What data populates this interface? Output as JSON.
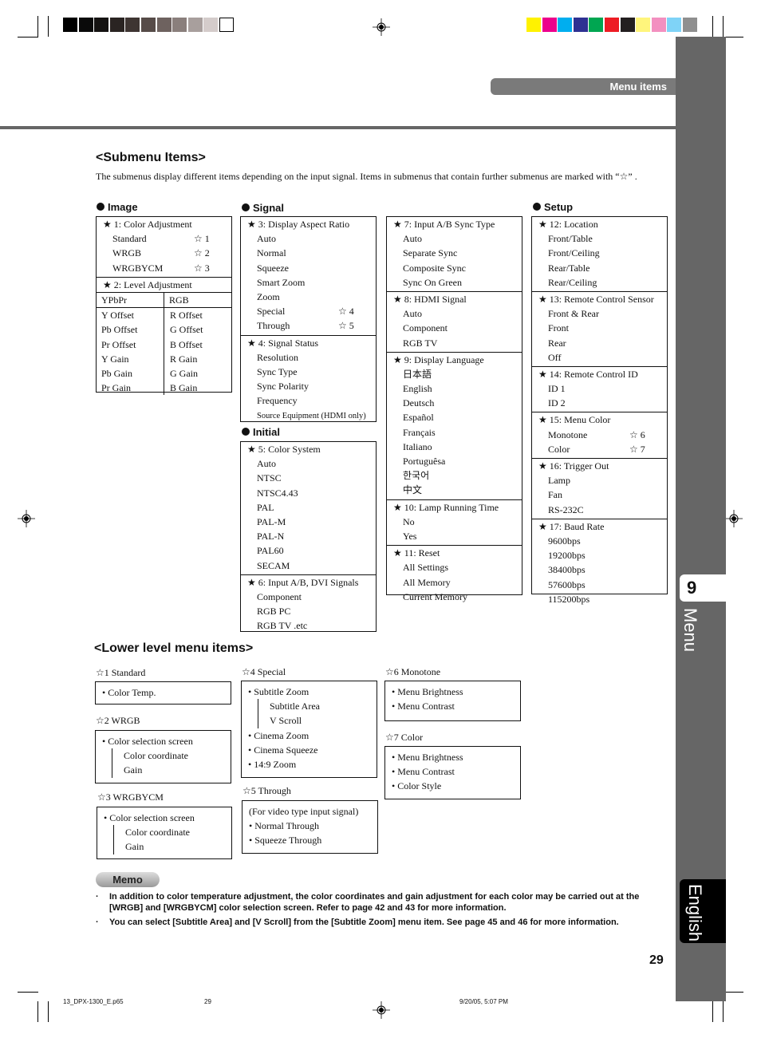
{
  "header": {
    "section_badge": "Menu items"
  },
  "side_tab": {
    "chapter_number": "9",
    "chapter_name": "Menu",
    "language": "English"
  },
  "color_bars": {
    "gray": [
      "#000000",
      "#0a0a0a",
      "#151312",
      "#2a2422",
      "#3e3532",
      "#564b48",
      "#6e625f",
      "#8a7f7c",
      "#a89f9d",
      "#d4cccb",
      "#ffffff"
    ],
    "color": [
      "#fff200",
      "#ec008c",
      "#00aeef",
      "#2e3192",
      "#00a651",
      "#ed1c24",
      "#231f20",
      "#fff57c",
      "#f390c0",
      "#7fd3f7",
      "#8f8f8f"
    ]
  },
  "submenu": {
    "title": "<Submenu Items>",
    "intro": "The submenus display different items depending on the input signal. Items in submenus that contain further submenus are marked with “☆” .",
    "sections": {
      "image": {
        "title": "Image",
        "groups": [
          {
            "head": "★ 1: Color Adjustment",
            "items": [
              {
                "label": "Standard",
                "ref": "☆ 1"
              },
              {
                "label": "WRGB",
                "ref": "☆ 2"
              },
              {
                "label": "WRGBYCM",
                "ref": "☆ 3"
              }
            ]
          },
          {
            "head": "★ 2: Level Adjustment",
            "table": {
              "headers": [
                "YPbPr",
                "RGB"
              ],
              "rows": [
                [
                  "Y Offset",
                  "R Offset"
                ],
                [
                  "Pb Offset",
                  "G Offset"
                ],
                [
                  "Pr Offset",
                  "B Offset"
                ],
                [
                  "Y Gain",
                  "R Gain"
                ],
                [
                  "Pb Gain",
                  "G Gain"
                ],
                [
                  "Pr Gain",
                  "B Gain"
                ]
              ]
            }
          }
        ]
      },
      "signal": {
        "title": "Signal",
        "groups": [
          {
            "head": "★ 3: Display Aspect Ratio",
            "items": [
              {
                "label": "Auto"
              },
              {
                "label": "Normal"
              },
              {
                "label": "Squeeze"
              },
              {
                "label": "Smart Zoom"
              },
              {
                "label": "Zoom"
              },
              {
                "label": "Special",
                "ref": "☆ 4"
              },
              {
                "label": "Through",
                "ref": "☆ 5"
              }
            ]
          },
          {
            "head": "★ 4: Signal Status",
            "items": [
              {
                "label": "Resolution"
              },
              {
                "label": "Sync Type"
              },
              {
                "label": "Sync Polarity"
              },
              {
                "label": "Frequency"
              },
              {
                "label": "Source Equipment (HDMI only)"
              }
            ]
          }
        ]
      },
      "initial": {
        "title": "Initial",
        "groups": [
          {
            "head": "★ 5: Color System",
            "items": [
              {
                "label": "Auto"
              },
              {
                "label": "NTSC"
              },
              {
                "label": "NTSC4.43"
              },
              {
                "label": "PAL"
              },
              {
                "label": "PAL-M"
              },
              {
                "label": "PAL-N"
              },
              {
                "label": "PAL60"
              },
              {
                "label": "SECAM"
              }
            ]
          },
          {
            "head": "★ 6: Input A/B, DVI Signals",
            "items": [
              {
                "label": "Component"
              },
              {
                "label": "RGB PC"
              },
              {
                "label": "RGB TV .etc"
              }
            ]
          }
        ]
      },
      "initial2": {
        "groups": [
          {
            "head": "★ 7: Input A/B Sync Type",
            "items": [
              {
                "label": "Auto"
              },
              {
                "label": "Separate Sync"
              },
              {
                "label": "Composite Sync"
              },
              {
                "label": "Sync On Green"
              }
            ]
          },
          {
            "head": "★ 8: HDMI Signal",
            "items": [
              {
                "label": "Auto"
              },
              {
                "label": "Component"
              },
              {
                "label": "RGB TV"
              }
            ]
          },
          {
            "head": "★ 9: Display Language",
            "items": [
              {
                "label": "日本語"
              },
              {
                "label": "English"
              },
              {
                "label": "Deutsch"
              },
              {
                "label": "Español"
              },
              {
                "label": "Français"
              },
              {
                "label": "Italiano"
              },
              {
                "label": "Portuguêsa"
              },
              {
                "label": "한국어"
              },
              {
                "label": "中文"
              }
            ]
          },
          {
            "head": "★ 10: Lamp Running Time",
            "items": [
              {
                "label": "No"
              },
              {
                "label": "Yes"
              }
            ]
          },
          {
            "head": "★ 11: Reset",
            "items": [
              {
                "label": "All Settings"
              },
              {
                "label": "All Memory"
              },
              {
                "label": "Current Memory"
              }
            ]
          }
        ]
      },
      "setup": {
        "title": "Setup",
        "groups": [
          {
            "head": "★ 12: Location",
            "items": [
              {
                "label": "Front/Table"
              },
              {
                "label": "Front/Ceiling"
              },
              {
                "label": "Rear/Table"
              },
              {
                "label": "Rear/Ceiling"
              }
            ]
          },
          {
            "head": "★ 13: Remote Control Sensor",
            "items": [
              {
                "label": "Front & Rear"
              },
              {
                "label": "Front"
              },
              {
                "label": "Rear"
              },
              {
                "label": "Off"
              }
            ]
          },
          {
            "head": "★ 14: Remote Control ID",
            "items": [
              {
                "label": "ID 1"
              },
              {
                "label": "ID 2"
              }
            ]
          },
          {
            "head": "★ 15: Menu Color",
            "items": [
              {
                "label": "Monotone",
                "ref": "☆ 6"
              },
              {
                "label": "Color",
                "ref": "☆ 7"
              }
            ]
          },
          {
            "head": "★ 16: Trigger Out",
            "items": [
              {
                "label": "Lamp"
              },
              {
                "label": "Fan"
              },
              {
                "label": "RS-232C"
              }
            ]
          },
          {
            "head": "★ 17: Baud Rate",
            "items": [
              {
                "label": "9600bps"
              },
              {
                "label": "19200bps"
              },
              {
                "label": "38400bps"
              },
              {
                "label": "57600bps"
              },
              {
                "label": "115200bps"
              }
            ]
          }
        ]
      }
    }
  },
  "lower": {
    "title": "<Lower level menu items>",
    "boxes": {
      "s1": {
        "head": "☆1 Standard",
        "lines": [
          "• Color Temp."
        ]
      },
      "s2": {
        "head": "☆2 WRGB",
        "lines": [
          "• Color selection screen",
          "Color coordinate",
          "Gain"
        ]
      },
      "s3": {
        "head": "☆3 WRGBYCM",
        "lines": [
          "• Color selection screen",
          "Color coordinate",
          "Gain"
        ]
      },
      "s4": {
        "head": "☆4 Special",
        "lines": [
          "• Subtitle Zoom",
          "Subtitle Area",
          "V Scroll",
          "• Cinema Zoom",
          "• Cinema Squeeze",
          "• 14:9 Zoom"
        ]
      },
      "s5": {
        "head": "☆5 Through",
        "lines": [
          "(For video type input signal)",
          "• Normal Through",
          "• Squeeze Through"
        ]
      },
      "s6": {
        "head": "☆6 Monotone",
        "lines": [
          "• Menu Brightness",
          "• Menu Contrast"
        ]
      },
      "s7": {
        "head": "☆7 Color",
        "lines": [
          "• Menu Brightness",
          "• Menu Contrast",
          "• Color Style"
        ]
      }
    }
  },
  "memo": {
    "label": "Memo",
    "notes": [
      "In addition to color temperature adjustment, the color coordinates and gain adjustment for each color may be carried out at the [WRGB] and [WRGBYCM] color selection screen. Refer to page 42 and 43 for more information.",
      "You can select [Subtitle Area] and [V Scroll] from the [Subtitle Zoom] menu item. See page 45 and 46 for more information."
    ],
    "bullet": "·"
  },
  "page_number": "29",
  "footer": {
    "file": "13_DPX-1300_E.p65",
    "page": "29",
    "date": "9/20/05, 5:07 PM"
  }
}
